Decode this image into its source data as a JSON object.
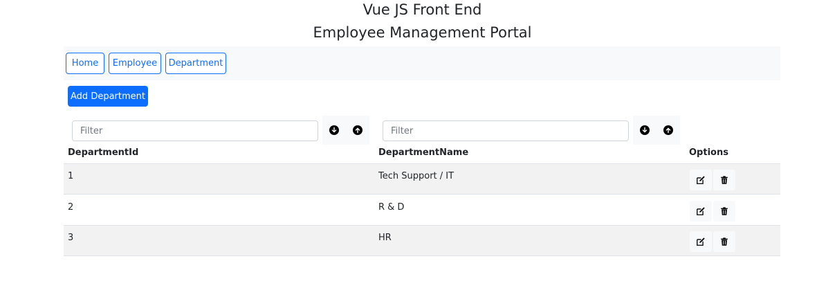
{
  "header": {
    "title_line1": "Vue JS Front End",
    "title_line2": "Employee Management Portal"
  },
  "nav": {
    "home": "Home",
    "employee": "Employee",
    "department": "Department"
  },
  "actions": {
    "add_department": "Add Department"
  },
  "filters": {
    "id_placeholder": "Filter",
    "name_placeholder": "Filter"
  },
  "table": {
    "columns": [
      "DepartmentId",
      "DepartmentName",
      "Options"
    ],
    "rows": [
      {
        "id": "1",
        "name": "Tech Support / IT"
      },
      {
        "id": "2",
        "name": "R & D"
      },
      {
        "id": "3",
        "name": "HR"
      }
    ]
  },
  "icons": {
    "sort_desc": "arrow-down-circle-icon",
    "sort_asc": "arrow-up-circle-icon",
    "edit": "pencil-square-icon",
    "delete": "trash-icon"
  },
  "colors": {
    "primary": "#0d6efd",
    "navbar_bg": "#f8f9fa",
    "stripe": "#f2f2f2"
  }
}
